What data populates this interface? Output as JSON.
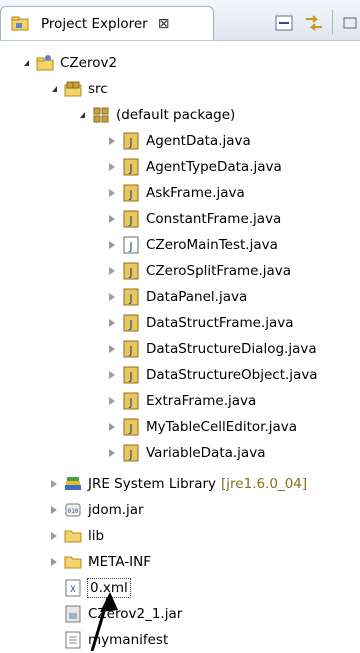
{
  "view": {
    "title": "Project Explorer",
    "close_glyph": "⊠"
  },
  "toolbar": {
    "collapse_icon": "collapse-all-icon",
    "link_icon": "link-with-editor-icon"
  },
  "colors": {
    "java_icon_bg": "#e9c75e",
    "folder": "#f3d36a",
    "package": "#c8a23a",
    "library_decor": "#8a6d1d"
  },
  "tree": {
    "project": "CZerov2",
    "src": "src",
    "package": "(default package)",
    "java_files": [
      "AgentData.java",
      "AgentTypeData.java",
      "AskFrame.java",
      "ConstantFrame.java",
      "CZeroMainTest.java",
      "CZeroSplitFrame.java",
      "DataPanel.java",
      "DataStructFrame.java",
      "DataStructureDialog.java",
      "DataStructureObject.java",
      "ExtraFrame.java",
      "MyTableCellEditor.java",
      "VariableData.java"
    ],
    "jre": {
      "name": "JRE System Library",
      "decoration": "[jre1.6.0_04]"
    },
    "jdom": "jdom.jar",
    "lib": "lib",
    "meta": "META-INF",
    "xml": "0.xml",
    "jar": "CZerov2_1.jar",
    "manifest": "mymanifest"
  }
}
